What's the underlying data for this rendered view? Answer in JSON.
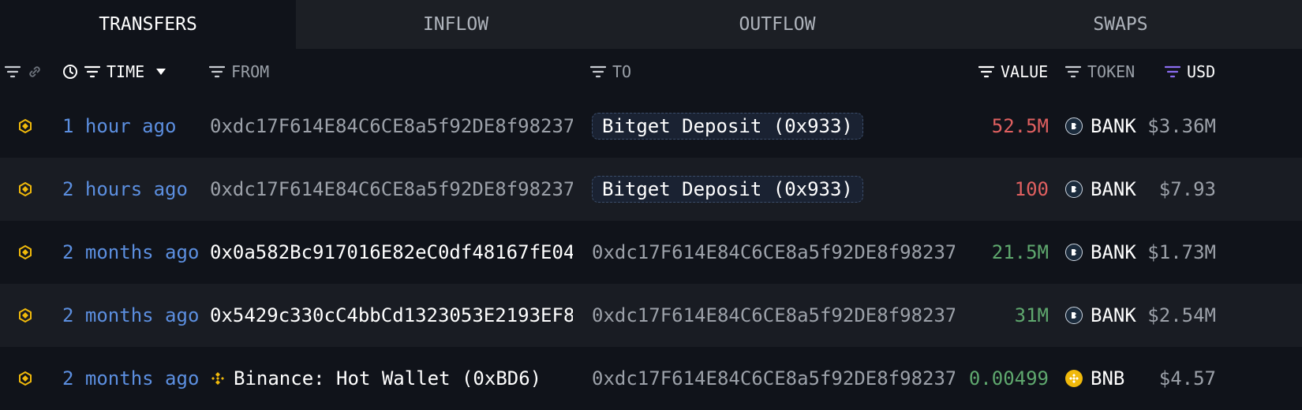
{
  "tabs": [
    {
      "label": "TRANSFERS",
      "active": true
    },
    {
      "label": "INFLOW",
      "active": false
    },
    {
      "label": "OUTFLOW",
      "active": false
    },
    {
      "label": "SWAPS",
      "active": false
    }
  ],
  "columns": {
    "time": "TIME",
    "from": "FROM",
    "to": "TO",
    "value": "VALUE",
    "token": "TOKEN",
    "usd": "USD"
  },
  "colors": {
    "background": "#10131a",
    "tab_bar": "#1c1f25",
    "time_link": "#5c8fe0",
    "value_out": "#e06060",
    "value_in": "#5fa86e",
    "chain_icon": "#f0b90b",
    "usd_sort_icon": "#8a6cf0"
  },
  "rows": [
    {
      "chain_icon": "bnb-chain-icon",
      "time": "1 hour ago",
      "from": "0xdc17F614E84C6CE8a5f92DE8f98237…",
      "to": "Bitget Deposit (0x933)",
      "value": "52.5M",
      "token": "BANK",
      "usd": "$3.36M"
    },
    {
      "chain_icon": "bnb-chain-icon",
      "time": "2 hours ago",
      "from": "0xdc17F614E84C6CE8a5f92DE8f98237…",
      "to": "Bitget Deposit (0x933)",
      "value": "100",
      "token": "BANK",
      "usd": "$7.93"
    },
    {
      "chain_icon": "bnb-chain-icon",
      "time": "2 months ago",
      "from": "0x0a582Bc917016E82eC0df48167fE04…",
      "to": "0xdc17F614E84C6CE8a5f92DE8f98237…",
      "value": "21.5M",
      "token": "BANK",
      "usd": "$1.73M"
    },
    {
      "chain_icon": "bnb-chain-icon",
      "time": "2 months ago",
      "from": "0x5429c330cC4bbCd1323053E2193EF8…",
      "to": "0xdc17F614E84C6CE8a5f92DE8f98237…",
      "value": "31M",
      "token": "BANK",
      "usd": "$2.54M"
    },
    {
      "chain_icon": "bnb-chain-icon",
      "time": "2 months ago",
      "from": "Binance: Hot Wallet (0xBD6)",
      "to": "0xdc17F614E84C6CE8a5f92DE8f98237…",
      "value": "0.00499",
      "token": "BNB",
      "usd": "$4.57"
    }
  ]
}
